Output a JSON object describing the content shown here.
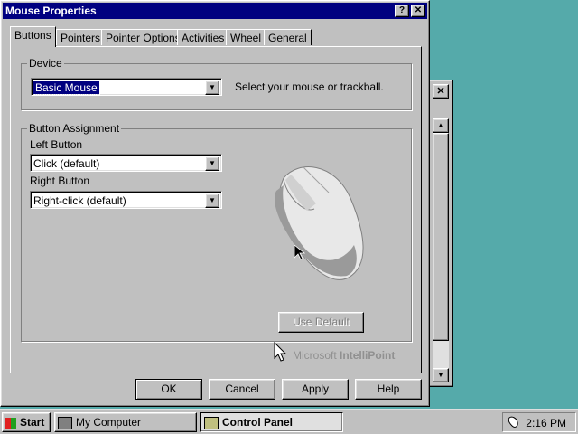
{
  "window": {
    "title": "Mouse Properties",
    "help_glyph": "?",
    "close_glyph": "✕"
  },
  "tabs": [
    {
      "label": "Buttons",
      "active": true
    },
    {
      "label": "Pointers"
    },
    {
      "label": "Pointer Options"
    },
    {
      "label": "Activities"
    },
    {
      "label": "Wheel"
    },
    {
      "label": "General"
    }
  ],
  "device": {
    "legend": "Device",
    "selected": "Basic Mouse",
    "hint": "Select your mouse or trackball."
  },
  "button_assignment": {
    "legend": "Button Assignment",
    "left_label": "Left Button",
    "left_value": "Click (default)",
    "right_label": "Right Button",
    "right_value": "Right-click (default)",
    "use_default": "Use Default"
  },
  "branding": {
    "prefix": "Microsoft",
    "product": "IntelliPoint"
  },
  "footer": {
    "ok": "OK",
    "cancel": "Cancel",
    "apply": "Apply",
    "help": "Help"
  },
  "taskbar": {
    "start": "Start",
    "tasks": [
      {
        "label": "My Computer"
      },
      {
        "label": "Control Panel",
        "active": true
      }
    ],
    "clock": "2:16 PM"
  },
  "colors": {
    "titlebar": "#000080",
    "desktop": "#55aaaa",
    "face": "#c0c0c0"
  }
}
